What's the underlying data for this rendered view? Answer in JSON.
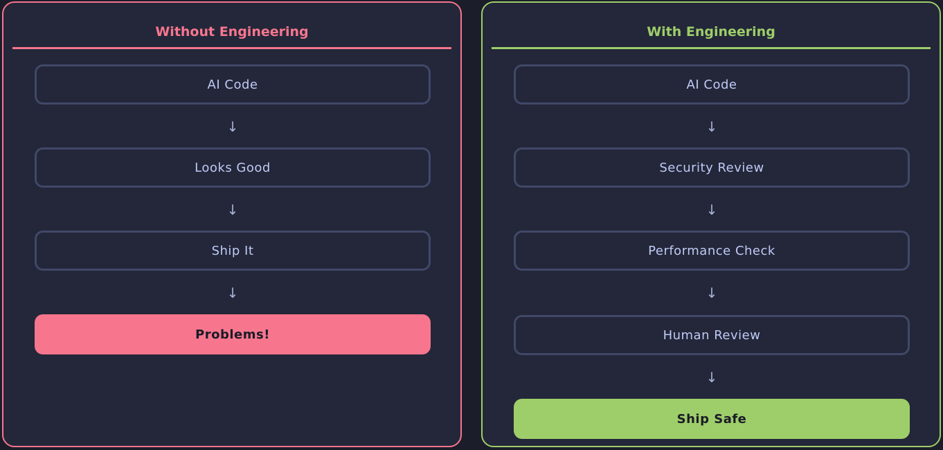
{
  "left_panel": {
    "title": "Without Engineering",
    "steps": [
      "AI Code",
      "Looks Good",
      "Ship It"
    ],
    "final": "Problems!",
    "accent": "#f7768e"
  },
  "right_panel": {
    "title": "With Engineering",
    "steps": [
      "AI Code",
      "Security Review",
      "Performance Check",
      "Human Review"
    ],
    "final": "Ship Safe",
    "accent": "#9ece6a"
  },
  "arrow_glyph": "↓"
}
